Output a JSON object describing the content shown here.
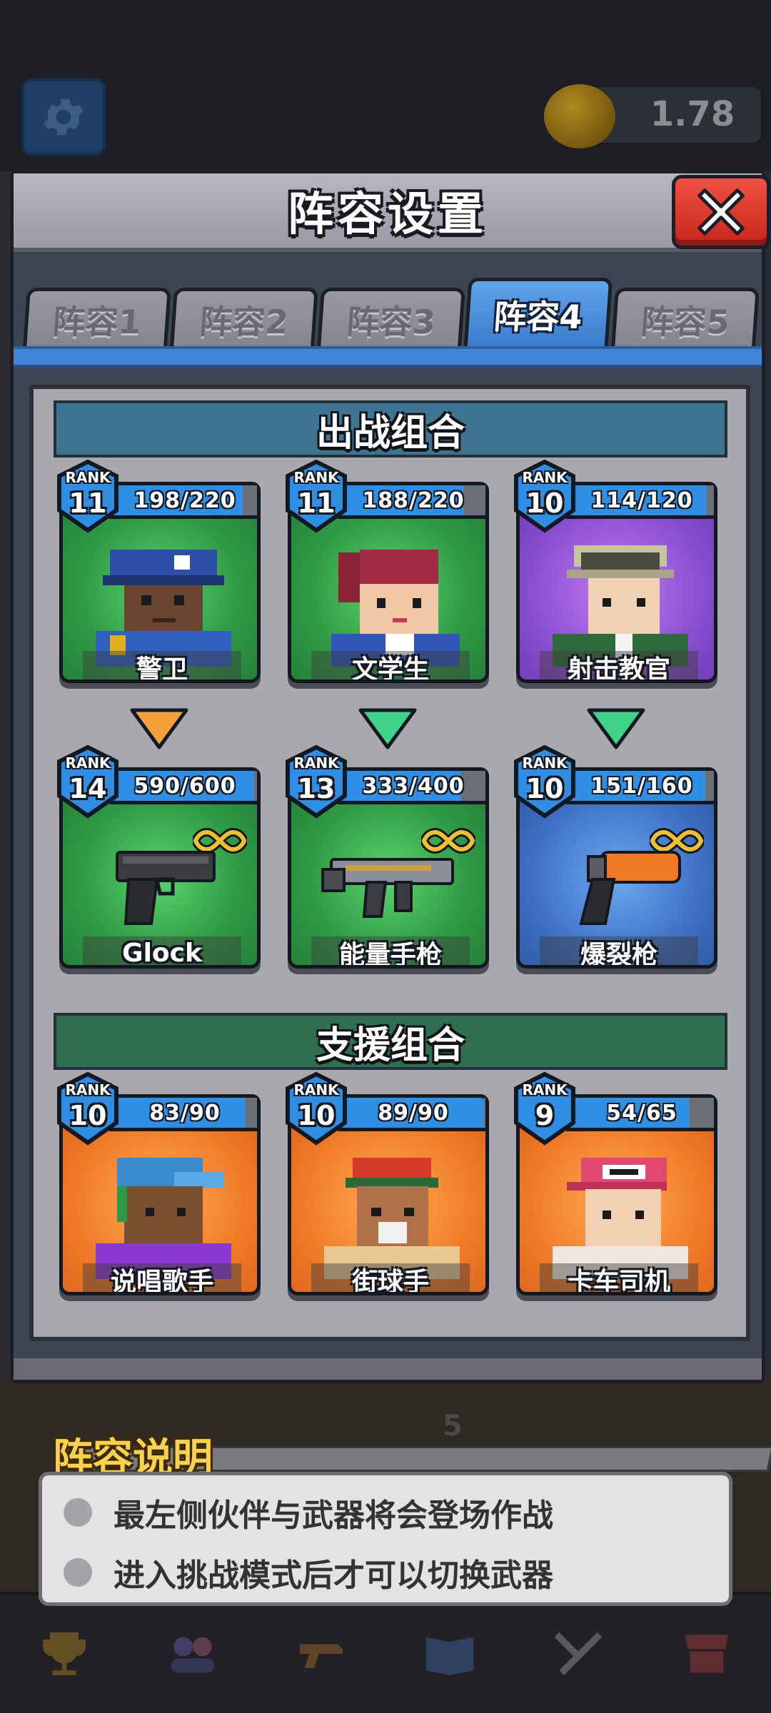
{
  "background": {
    "coin_value": "1.78",
    "ammo_count": "5"
  },
  "dialog": {
    "title": "阵容设置",
    "tabs": [
      {
        "label": "阵容1",
        "active": false
      },
      {
        "label": "阵容2",
        "active": false
      },
      {
        "label": "阵容3",
        "active": false
      },
      {
        "label": "阵容4",
        "active": true
      },
      {
        "label": "阵容5",
        "active": false
      }
    ]
  },
  "battle_section": {
    "title": "出战组合",
    "partners": [
      {
        "name": "警卫",
        "rank_label": "RANK",
        "rank": "11",
        "xp": "198/220",
        "xp_fraction": 0.9,
        "bg": "green",
        "arrow_color": "#f5a03a"
      },
      {
        "name": "文学生",
        "rank_label": "RANK",
        "rank": "11",
        "xp": "188/220",
        "xp_fraction": 0.85,
        "bg": "green",
        "arrow_color": "#3fd48a"
      },
      {
        "name": "射击教官",
        "rank_label": "RANK",
        "rank": "10",
        "xp": "114/120",
        "xp_fraction": 0.95,
        "bg": "purple",
        "arrow_color": "#3fd48a"
      }
    ],
    "weapons": [
      {
        "name": "Glock",
        "rank_label": "RANK",
        "rank": "14",
        "xp": "590/600",
        "xp_fraction": 0.98,
        "bg": "green",
        "icon": "pistol-icon"
      },
      {
        "name": "能量手枪",
        "rank_label": "RANK",
        "rank": "13",
        "xp": "333/400",
        "xp_fraction": 0.83,
        "bg": "green",
        "icon": "energy-gun-icon"
      },
      {
        "name": "爆裂枪",
        "rank_label": "RANK",
        "rank": "10",
        "xp": "151/160",
        "xp_fraction": 0.94,
        "bg": "blue",
        "icon": "flare-gun-icon"
      }
    ]
  },
  "support_section": {
    "title": "支援组合",
    "partners": [
      {
        "name": "说唱歌手",
        "rank_label": "RANK",
        "rank": "10",
        "xp": "83/90",
        "xp_fraction": 0.92,
        "bg": "orange"
      },
      {
        "name": "街球手",
        "rank_label": "RANK",
        "rank": "10",
        "xp": "89/90",
        "xp_fraction": 0.99,
        "bg": "orange"
      },
      {
        "name": "卡车司机",
        "rank_label": "RANK",
        "rank": "9",
        "xp": "54/65",
        "xp_fraction": 0.83,
        "bg": "orange"
      }
    ]
  },
  "info": {
    "title": "阵容说明",
    "lines": [
      "最左侧伙伴与武器将会登场作战",
      "进入挑战模式后才可以切换武器"
    ]
  },
  "colors": {
    "tab_active": "#3f86d6",
    "close_button": "#e0382c",
    "xp_fill": "#2f8fe4",
    "rank_badge": "#2f8fe4"
  }
}
